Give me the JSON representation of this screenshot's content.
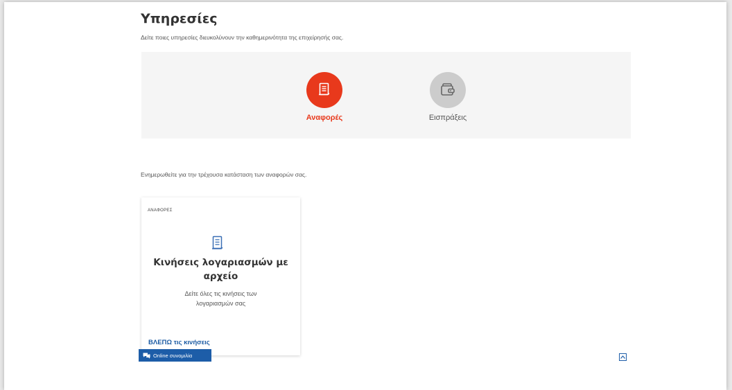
{
  "page": {
    "title": "Υπηρεσίες",
    "subtitle": "Δείτε ποιες υπηρεσίες διευκολύνουν την καθημερινότητα της επιχείρησής σας."
  },
  "services": {
    "tabs": [
      {
        "label": "Αναφορές",
        "icon": "document-icon",
        "active": true,
        "color": "#e8391c"
      },
      {
        "label": "Εισπράξεις",
        "icon": "wallet-icon",
        "active": false,
        "color": "#cccccc"
      }
    ]
  },
  "info_text": "Ενημερωθείτε για την τρέχουσα κατάσταση των αναφορών σας.",
  "report_card": {
    "category": "ΑΝΑΦΟΡΕΣ",
    "icon": "document-icon",
    "title": "Κινήσεις λογαριασμών με αρχείο",
    "description": "Δείτε όλες τις κινήσεις των λογαριασμών σας",
    "link_label": "ΒΛΕΠΩ τις κινήσεις"
  },
  "chat": {
    "label": "Online συνομιλία",
    "icon": "chat-icon"
  },
  "scroll_top": {
    "icon": "chevron-up-icon"
  },
  "colors": {
    "accent": "#e8391c",
    "link": "#1a5aa3",
    "chat_bg": "#1d5da8",
    "panel_bg": "#f5f5f5"
  }
}
